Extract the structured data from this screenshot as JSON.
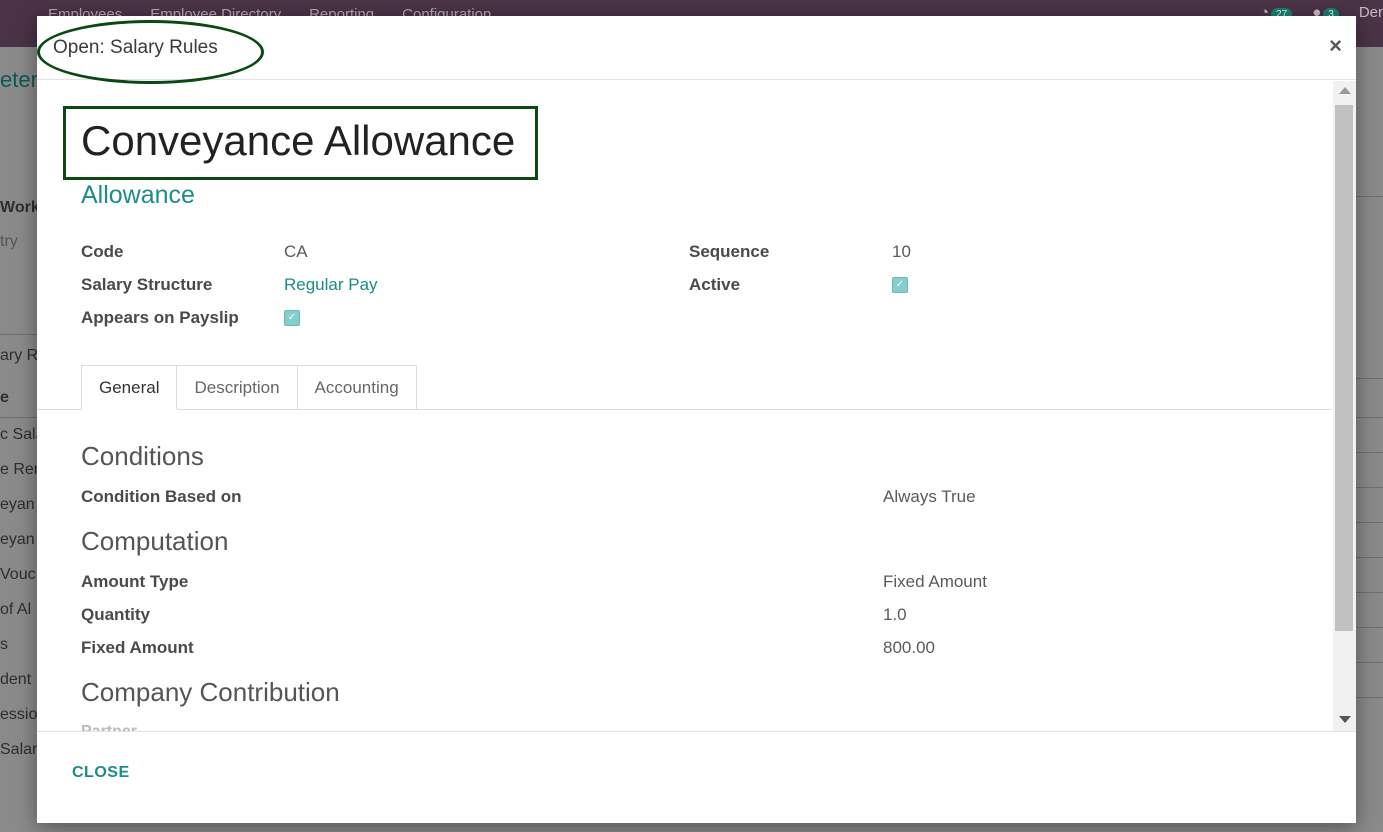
{
  "background": {
    "menu": [
      "Employees",
      "Employee Directory",
      "Reporting",
      "Configuration"
    ],
    "activity_count": "27",
    "message_count": "3",
    "user_partial": "Der",
    "left_fragments": [
      "eter",
      "Work",
      "try",
      "ary R",
      "e",
      "c Sala",
      "e Ren",
      "eyan",
      "eyan",
      "Vouc",
      "of Al",
      "s",
      "dent",
      "ession",
      "Salary"
    ]
  },
  "dialog": {
    "title": "Open: Salary Rules",
    "close_symbol": "×",
    "footer_close_label": "CLOSE"
  },
  "record": {
    "name": "Conveyance Allowance",
    "category": "Allowance",
    "fields": {
      "code_label": "Code",
      "code_value": "CA",
      "structure_label": "Salary Structure",
      "structure_value": "Regular Pay",
      "appears_label": "Appears on Payslip",
      "appears_checked": true,
      "sequence_label": "Sequence",
      "sequence_value": "10",
      "active_label": "Active",
      "active_checked": true
    },
    "tabs": [
      "General",
      "Description",
      "Accounting"
    ],
    "general": {
      "conditions_heading": "Conditions",
      "condition_label": "Condition Based on",
      "condition_value": "Always True",
      "computation_heading": "Computation",
      "amount_type_label": "Amount Type",
      "amount_type_value": "Fixed Amount",
      "quantity_label": "Quantity",
      "quantity_value": "1.0",
      "fixed_amount_label": "Fixed Amount",
      "fixed_amount_value": "800.00",
      "company_heading": "Company Contribution",
      "partner_label": "Partner"
    }
  },
  "colors": {
    "accent": "#1b8d87",
    "annotation": "#0a4a12",
    "topbar": "#4a3346"
  }
}
